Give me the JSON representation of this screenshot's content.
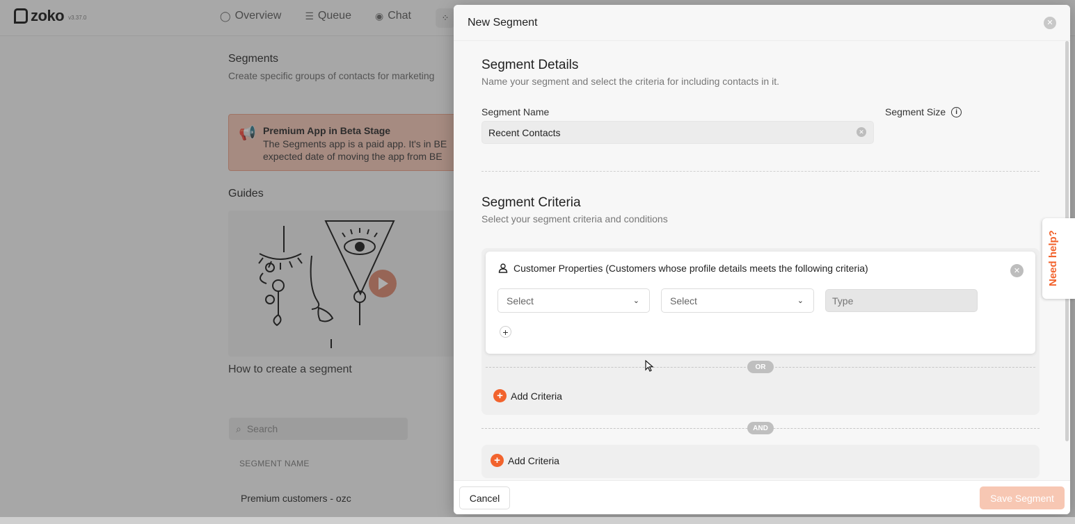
{
  "app": {
    "logo_text": "zoko",
    "version": "v3.37.0"
  },
  "nav": {
    "items": [
      {
        "label": "Overview",
        "icon": "circle-icon"
      },
      {
        "label": "Queue",
        "icon": "list-icon"
      },
      {
        "label": "Chat",
        "icon": "chat-icon"
      }
    ]
  },
  "background": {
    "title": "Segments",
    "subtitle": "Create specific groups of contacts for marketing",
    "beta": {
      "title": "Premium App in Beta Stage",
      "text_line1": "The Segments app is a paid app. It's in BE",
      "text_line2": "expected date of moving the app from BE"
    },
    "guides_title": "Guides",
    "video_caption": "How to create a segment",
    "search_placeholder": "Search",
    "column_header": "SEGMENT NAME",
    "rows": [
      "Premium customers - ozc"
    ]
  },
  "modal": {
    "title": "New Segment",
    "details": {
      "title": "Segment Details",
      "subtitle": "Name your segment and select the criteria for including contacts in it.",
      "name_label": "Segment Name",
      "name_value": "Recent Contacts",
      "size_label": "Segment Size"
    },
    "criteria": {
      "title": "Segment Criteria",
      "subtitle": "Select your segment criteria and conditions",
      "group_heading": "Customer Properties (Customers whose profile details meets the following criteria)",
      "select1_placeholder": "Select",
      "select2_placeholder": "Select",
      "type_placeholder": "Type",
      "or_label": "OR",
      "and_label": "AND",
      "add_criteria_label": "Add Criteria"
    },
    "footer": {
      "cancel_label": "Cancel",
      "save_label": "Save Segment"
    }
  },
  "help_tab": {
    "label": "Need help?"
  },
  "colors": {
    "accent": "#f2632d",
    "beta_bg": "#f3c4b4",
    "save_disabled": "#f7c7b3"
  }
}
